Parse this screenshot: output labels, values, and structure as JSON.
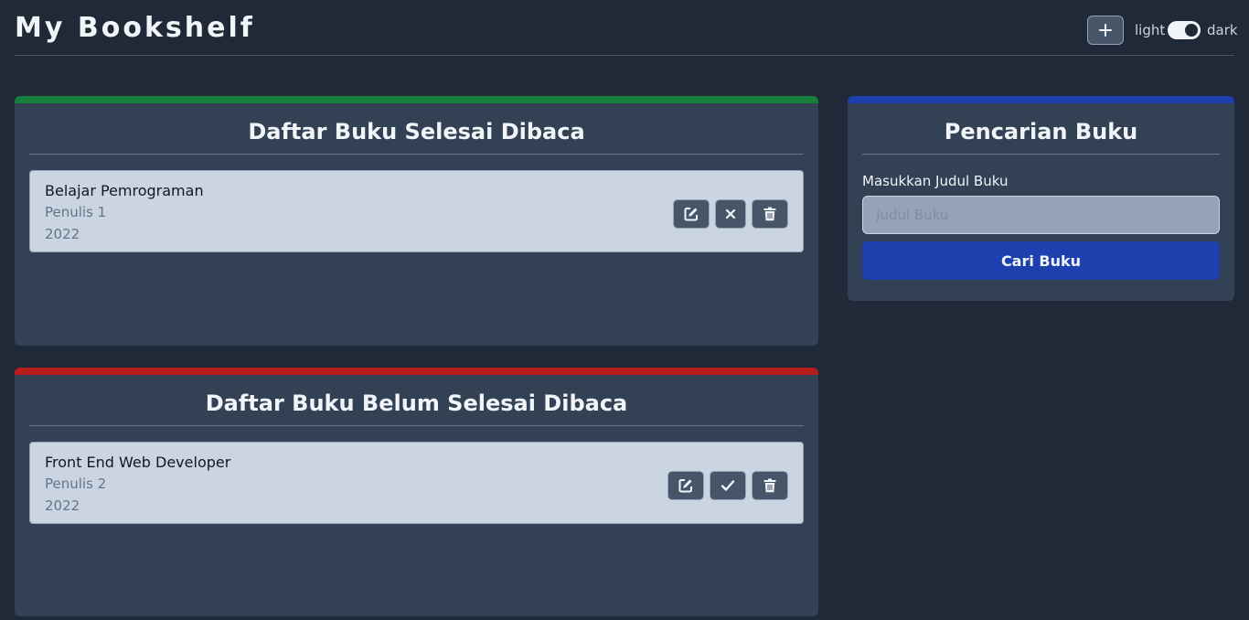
{
  "header": {
    "title": "My Bookshelf",
    "add_icon": "plus-icon",
    "theme_light_label": "light",
    "theme_dark_label": "dark",
    "theme_mode": "dark"
  },
  "finished": {
    "title": "Daftar Buku Selesai Dibaca",
    "accent": "#15803d",
    "books": [
      {
        "title": "Belajar Pemrograman",
        "author": "Penulis 1",
        "year": "2022"
      }
    ]
  },
  "unfinished": {
    "title": "Daftar Buku Belum Selesai Dibaca",
    "accent": "#b91c1c",
    "books": [
      {
        "title": "Front End Web Developer",
        "author": "Penulis 2",
        "year": "2022"
      }
    ]
  },
  "search": {
    "title": "Pencarian Buku",
    "accent": "#1e40af",
    "label": "Masukkan Judul Buku",
    "placeholder": "Judul Buku",
    "value": "",
    "button_label": "Cari Buku"
  }
}
